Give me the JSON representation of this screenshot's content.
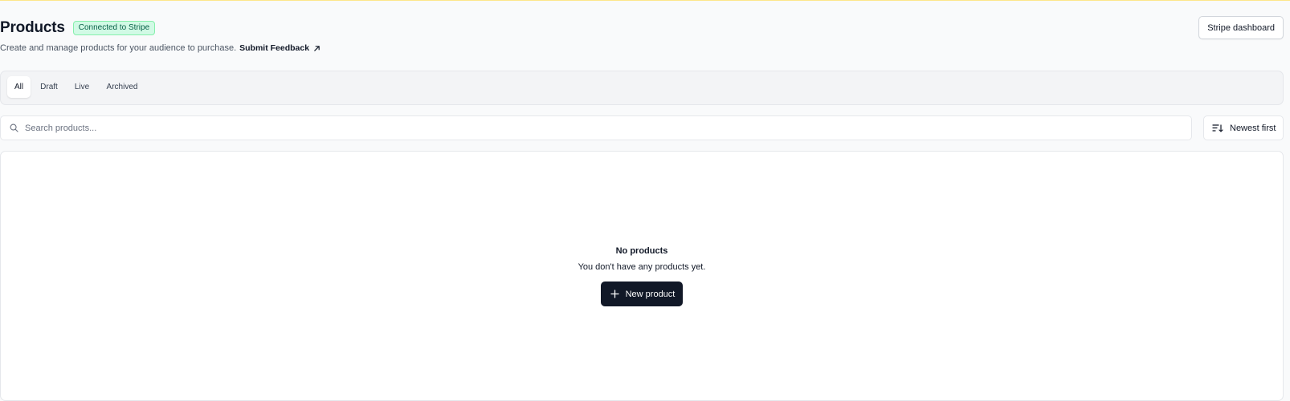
{
  "header": {
    "title": "Products",
    "badge": "Connected to Stripe",
    "subtitle": "Create and manage products for your audience to purchase.",
    "feedback_link": "Submit Feedback",
    "stripe_button": "Stripe dashboard"
  },
  "tabs": [
    {
      "label": "All",
      "active": true
    },
    {
      "label": "Draft",
      "active": false
    },
    {
      "label": "Live",
      "active": false
    },
    {
      "label": "Archived",
      "active": false
    }
  ],
  "search": {
    "placeholder": "Search products...",
    "value": ""
  },
  "sort": {
    "label": "Newest first",
    "icon": "sort-descending-icon"
  },
  "empty_state": {
    "title": "No products",
    "text": "You don't have any products yet.",
    "button": "New product",
    "button_icon": "plus-icon"
  },
  "colors": {
    "badge_bg": "#d1fae5",
    "badge_text": "#065f46",
    "primary_button": "#111827",
    "top_accent": "#fde68a"
  }
}
